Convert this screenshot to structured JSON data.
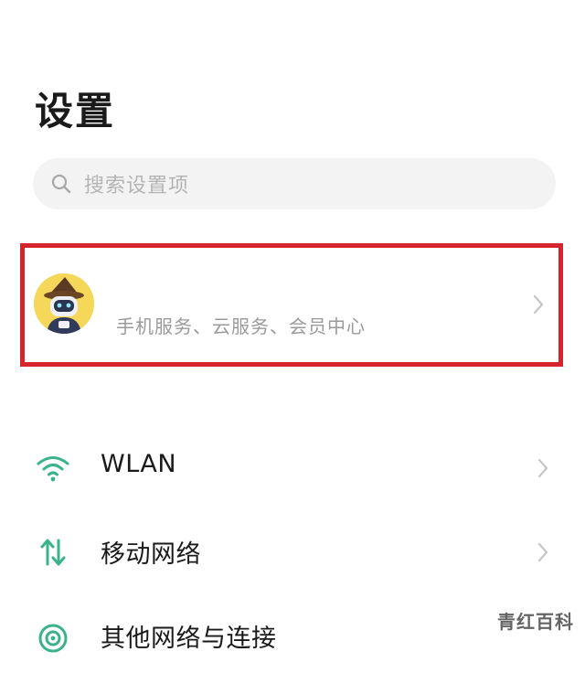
{
  "header": {
    "title": "设置"
  },
  "search": {
    "placeholder": "搜索设置项"
  },
  "account": {
    "subtitle": "手机服务、云服务、会员中心"
  },
  "settings": {
    "items": [
      {
        "label": "WLAN",
        "icon": "wifi-icon"
      },
      {
        "label": "移动网络",
        "icon": "mobile-network-icon"
      },
      {
        "label": "其他网络与连接",
        "icon": "other-network-icon"
      }
    ]
  },
  "watermark": {
    "text": "青红百科"
  },
  "colors": {
    "accent": "#3bb38a",
    "highlight_border": "#d5242c",
    "chevron": "#c6c6c6"
  }
}
